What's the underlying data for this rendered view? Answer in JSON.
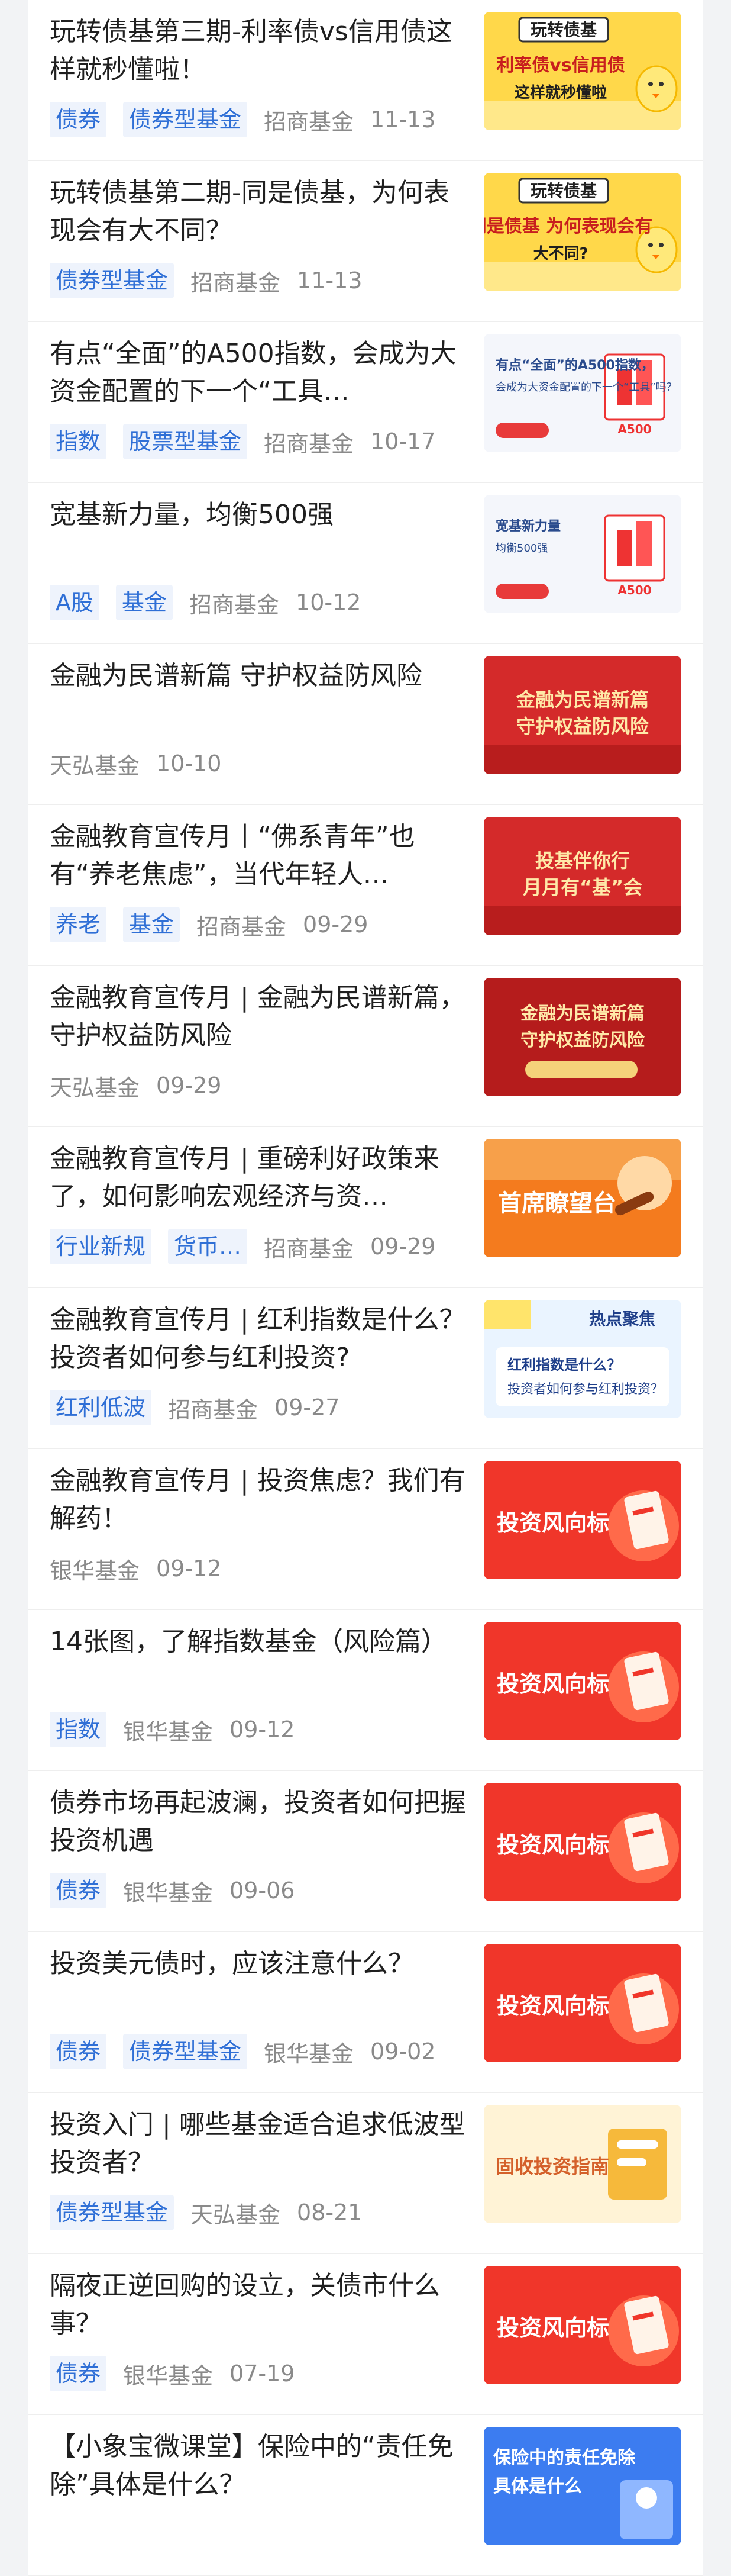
{
  "articles": [
    {
      "title": "玩转债基第三期-利率债vs信用债这样就秒懂啦！",
      "tags": [
        "债券",
        "债券型基金"
      ],
      "source": "招商基金",
      "date": "11-13",
      "thumb": {
        "style": "yellow",
        "banner": "玩转债基",
        "text1": "利率债vs信用债",
        "text2": "这样就秒懂啦"
      }
    },
    {
      "title": "玩转债基第二期-同是债基，为何表现会有大不同？",
      "tags": [
        "债券型基金"
      ],
      "source": "招商基金",
      "date": "11-13",
      "thumb": {
        "style": "yellow",
        "banner": "玩转债基",
        "text1": "同是债基 为何表现会有",
        "text2": "大不同?"
      }
    },
    {
      "title": "有点“全面”的A500指数，会成为大资金配置的下一个“工具…",
      "tags": [
        "指数",
        "股票型基金"
      ],
      "source": "招商基金",
      "date": "10-17",
      "thumb": {
        "style": "light",
        "text1": "有点“全面”的A500指数，",
        "text2": "会成为大资金配置的下一个“工具”吗？",
        "badge": "A500"
      }
    },
    {
      "title": "宽基新力量，均衡500强",
      "tags": [
        "A股",
        "基金"
      ],
      "source": "招商基金",
      "date": "10-12",
      "thumb": {
        "style": "light",
        "text1": "宽基新力量",
        "text2": "均衡500强",
        "badge": "A500"
      }
    },
    {
      "title": "金融为民谱新篇 守护权益防风险",
      "tags": [],
      "source": "天弘基金",
      "date": "10-10",
      "thumb": {
        "style": "red",
        "text1": "金融为民谱新篇",
        "text2": "守护权益防风险"
      }
    },
    {
      "title": "金融教育宣传月丨“佛系青年”也有“养老焦虑”，当代年轻人…",
      "tags": [
        "养老",
        "基金"
      ],
      "source": "招商基金",
      "date": "09-29",
      "thumb": {
        "style": "red",
        "text1": "投基伴你行",
        "text2": "月月有“基”会"
      }
    },
    {
      "title": "金融教育宣传月 | 金融为民谱新篇，守护权益防风险",
      "tags": [],
      "source": "天弘基金",
      "date": "09-29",
      "thumb": {
        "style": "darkred",
        "text1": "金融为民谱新篇",
        "text2": "守护权益防风险"
      }
    },
    {
      "title": "金融教育宣传月 | 重磅利好政策来了，如何影响宏观经济与资…",
      "tags": [
        "行业新规",
        "货币…"
      ],
      "source": "招商基金",
      "date": "09-29",
      "thumb": {
        "style": "orange",
        "text1": "首席瞭望台",
        "text2": ""
      }
    },
    {
      "title": "金融教育宣传月 | 红利指数是什么？投资者如何参与红利投资?",
      "tags": [
        "红利低波"
      ],
      "source": "招商基金",
      "date": "09-27",
      "thumb": {
        "style": "paleblue",
        "banner": "热点聚焦",
        "text1": "红利指数是什么？",
        "text2": "投资者如何参与红利投资？"
      }
    },
    {
      "title": "金融教育宣传月 | 投资焦虑？我们有解药！",
      "tags": [],
      "source": "银华基金",
      "date": "09-12",
      "thumb": {
        "style": "redfire",
        "text1": "投资风向标",
        "text2": ""
      }
    },
    {
      "title": "14张图，了解指数基金（风险篇）",
      "tags": [
        "指数"
      ],
      "source": "银华基金",
      "date": "09-12",
      "thumb": {
        "style": "redfire",
        "text1": "投资风向标",
        "text2": ""
      }
    },
    {
      "title": "债券市场再起波澜，投资者如何把握投资机遇",
      "tags": [
        "债券"
      ],
      "source": "银华基金",
      "date": "09-06",
      "thumb": {
        "style": "redfire",
        "text1": "投资风向标",
        "text2": ""
      }
    },
    {
      "title": "投资美元债时，应该注意什么？",
      "tags": [
        "债券",
        "债券型基金"
      ],
      "source": "银华基金",
      "date": "09-02",
      "thumb": {
        "style": "redfire",
        "text1": "投资风向标",
        "text2": ""
      }
    },
    {
      "title": "投资入门 | 哪些基金适合追求低波型投资者？",
      "tags": [
        "债券型基金"
      ],
      "source": "天弘基金",
      "date": "08-21",
      "thumb": {
        "style": "gold",
        "text1": "固收投资指南",
        "text2": ""
      }
    },
    {
      "title": "隔夜正逆回购的设立，关债市什么事？",
      "tags": [
        "债券"
      ],
      "source": "银华基金",
      "date": "07-19",
      "thumb": {
        "style": "redfire",
        "text1": "投资风向标",
        "text2": ""
      }
    },
    {
      "title": "【小象宝微课堂】保险中的“责任免除”具体是什么？",
      "tags": [],
      "source": "",
      "date": "",
      "thumb": {
        "style": "blue",
        "text1": "保险中的责任免除",
        "text2": "具体是什么"
      }
    }
  ],
  "colors": {
    "tag_bg": "#eef3fc",
    "tag_text": "#2f6fd6",
    "meta": "#8a8a8a",
    "title": "#1f1f1f"
  }
}
